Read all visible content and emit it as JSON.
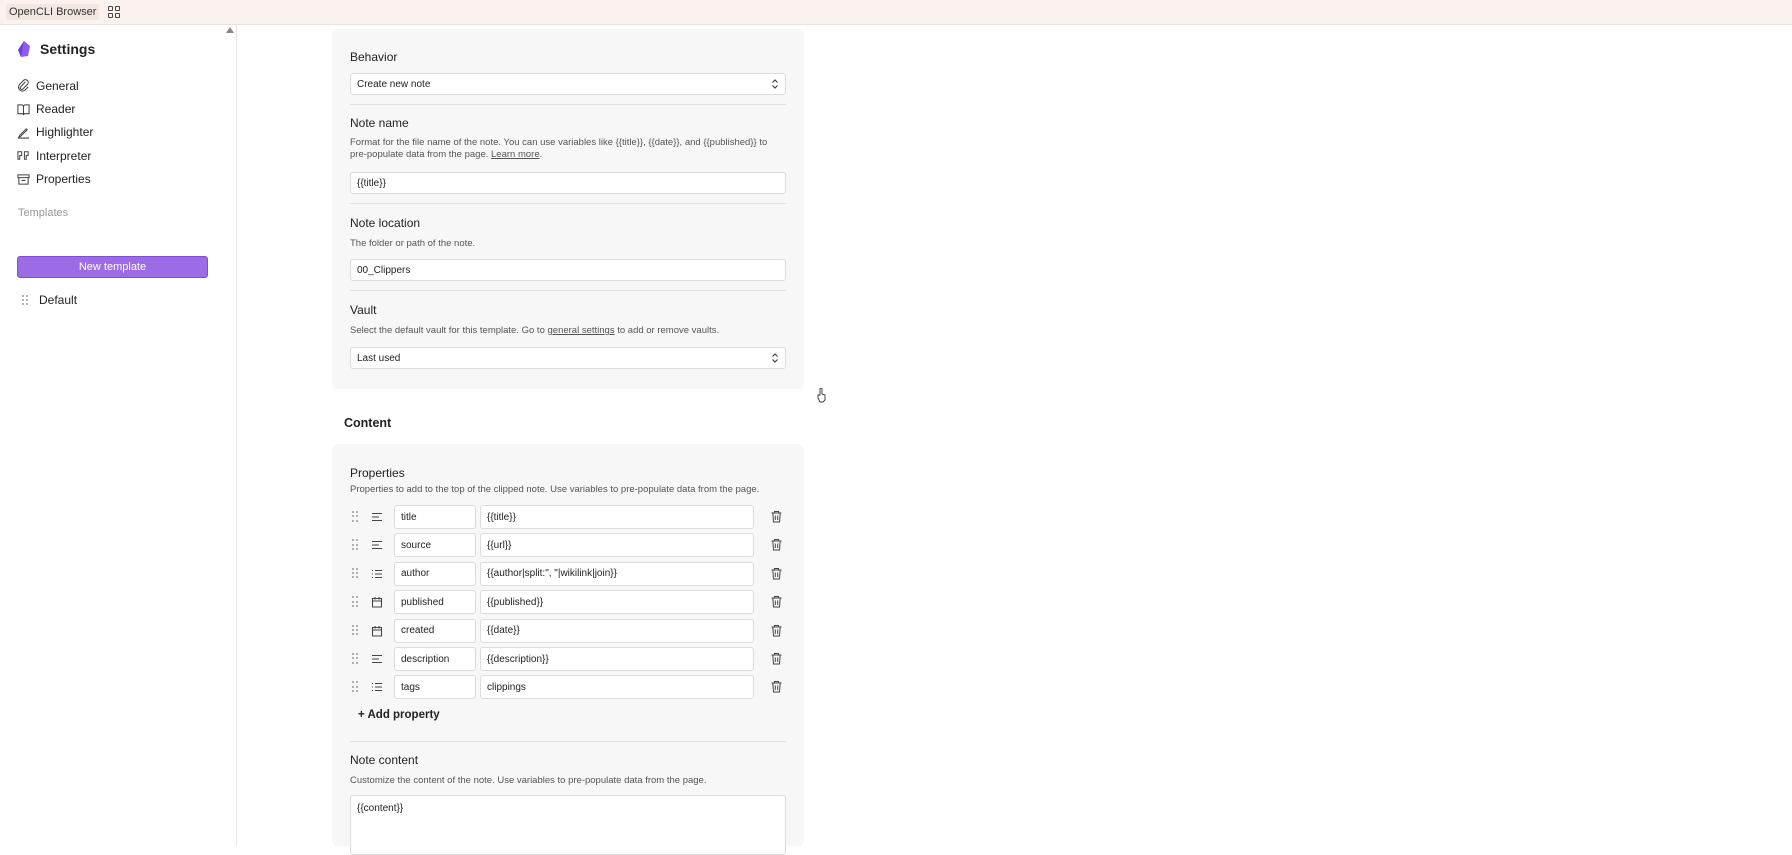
{
  "app": {
    "title": "OpenCLI Browser"
  },
  "sidebar": {
    "title": "Settings",
    "items": [
      {
        "label": "General",
        "icon": "paperclip-icon"
      },
      {
        "label": "Reader",
        "icon": "book-icon"
      },
      {
        "label": "Highlighter",
        "icon": "highlighter-icon"
      },
      {
        "label": "Interpreter",
        "icon": "quote-icon"
      },
      {
        "label": "Properties",
        "icon": "archive-icon"
      }
    ],
    "templates_label": "Templates",
    "new_template_label": "New template",
    "templates": [
      {
        "label": "Default"
      }
    ]
  },
  "behavior": {
    "title": "Behavior",
    "value": "Create new note"
  },
  "note_name": {
    "title": "Note name",
    "desc_prefix": "Format for the file name of the note. You can use variables like {{title}}, {{date}}, and {{published}} to pre-populate data from the page. ",
    "desc_link": "Learn more",
    "desc_suffix": ".",
    "value": "{{title}}"
  },
  "note_location": {
    "title": "Note location",
    "desc": "The folder or path of the note.",
    "value": "00_Clippers"
  },
  "vault": {
    "title": "Vault",
    "desc_prefix": "Select the default vault for this template. Go to ",
    "desc_link": "general settings",
    "desc_suffix": " to add or remove vaults.",
    "value": "Last used"
  },
  "content": {
    "heading": "Content",
    "properties_title": "Properties",
    "properties_desc": "Properties to add to the top of the clipped note. Use variables to pre-populate data from the page.",
    "properties": [
      {
        "name": "title",
        "value": "{{title}}",
        "type": "text"
      },
      {
        "name": "source",
        "value": "{{url}}",
        "type": "text"
      },
      {
        "name": "author",
        "value": "{{author|split:\", \"|wikilink|join}}",
        "type": "list"
      },
      {
        "name": "published",
        "value": "{{published}}",
        "type": "date"
      },
      {
        "name": "created",
        "value": "{{date}}",
        "type": "date"
      },
      {
        "name": "description",
        "value": "{{description}}",
        "type": "text"
      },
      {
        "name": "tags",
        "value": "clippings",
        "type": "list"
      }
    ],
    "add_property_label": "+ Add property",
    "note_content_title": "Note content",
    "note_content_desc": "Customize the content of the note. Use variables to pre-populate data from the page.",
    "note_content_value": "{{content}}"
  },
  "colors": {
    "accent": "#9b6ce5",
    "card": "#f7f7f7",
    "topbar": "#fbf1ee"
  }
}
